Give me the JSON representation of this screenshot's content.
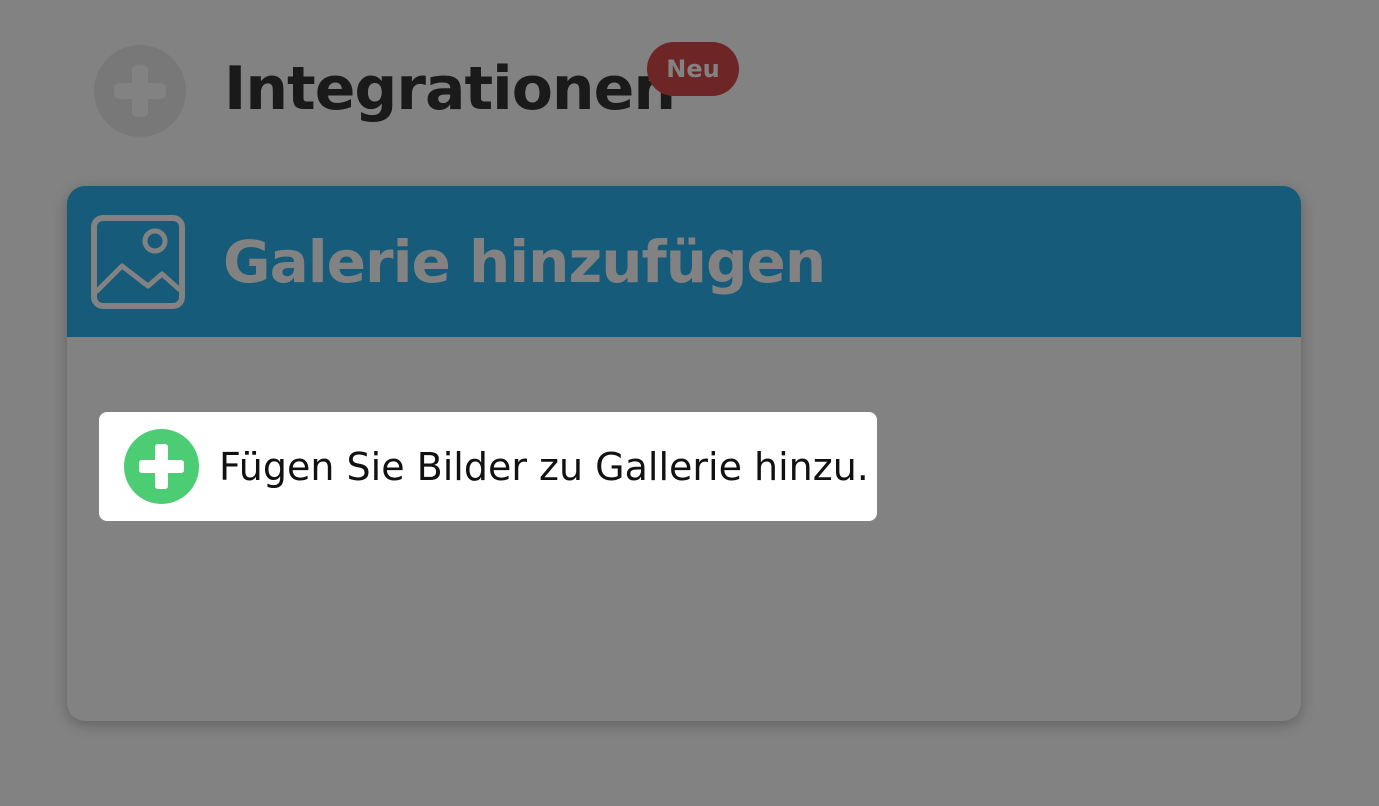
{
  "integrations": {
    "title": "Integrationen",
    "badge": "Neu",
    "icon": "plus-circle-icon"
  },
  "gallery_card": {
    "title": "Galerie hinzufügen",
    "icon": "image-icon",
    "header_color": "#2bb2f0"
  },
  "add_images": {
    "label": "Fügen Sie Bilder zu Gallerie hinzu.",
    "icon": "plus-circle-icon",
    "icon_color": "#4ccd74"
  },
  "colors": {
    "badge": "#d84a4a",
    "overlay": "rgba(0,0,0,0.49)"
  }
}
